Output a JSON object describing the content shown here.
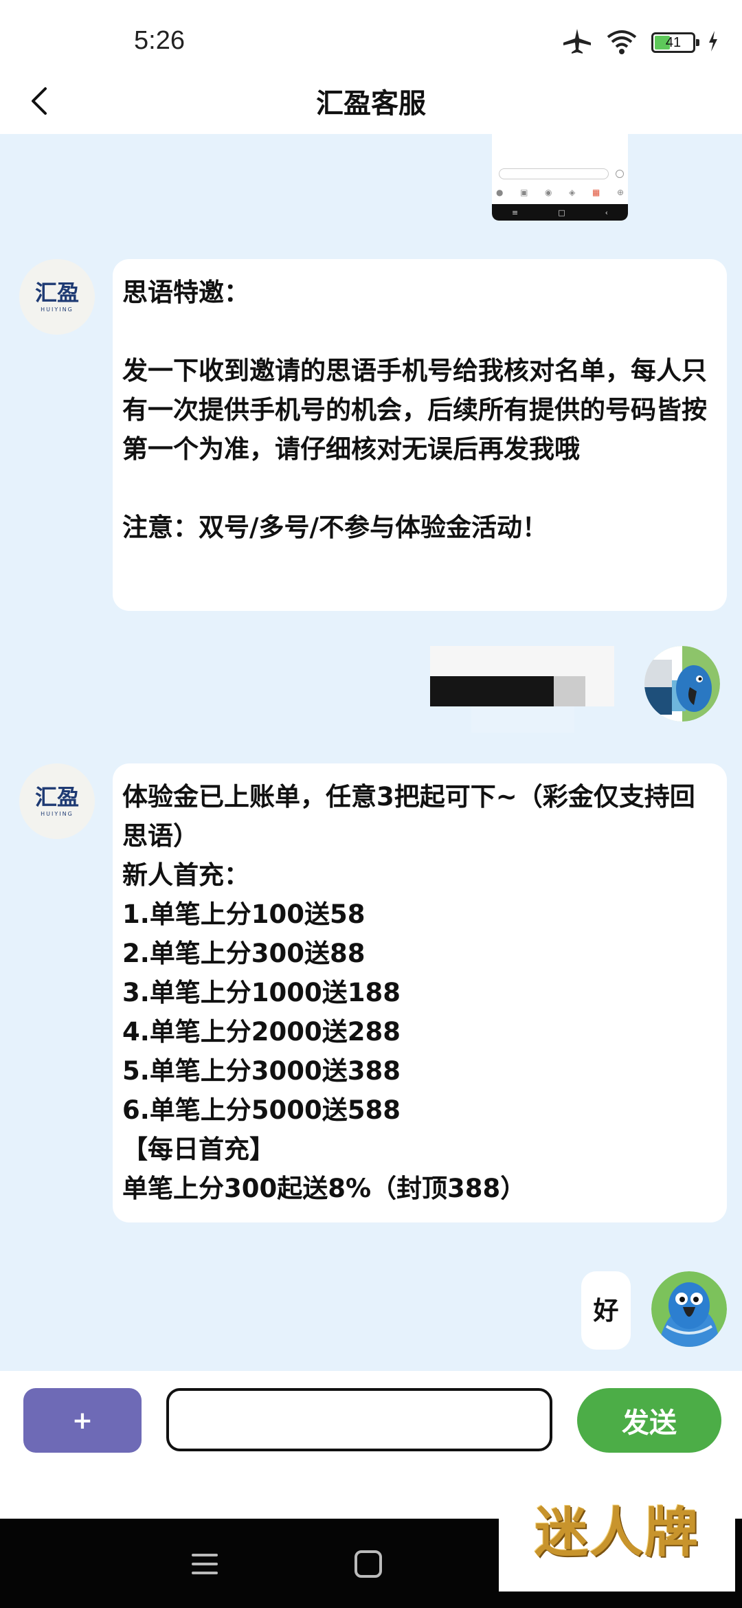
{
  "status_bar": {
    "time": "5:26",
    "battery_level": "41",
    "battery_fraction": 0.41
  },
  "header": {
    "title": "汇盈客服"
  },
  "chat": {
    "agent_logo": {
      "main": "汇盈",
      "sub": "HUIYING"
    },
    "messages": [
      {
        "from": "agent",
        "text": "思语特邀：\n\n发一下收到邀请的思语手机号给我核对名单，每人只有一次提供手机号的机会，后续所有提供的号码皆按第一个为准，请仔细核对无误后再发我哦\n\n注意：双号/多号/不参与体验金活动！"
      },
      {
        "from": "agent",
        "text": "体验金已上账单，任意3把起可下~（彩金仅支持回思语）\n新人首充：\n1.单笔上分100送58\n2.单笔上分300送88\n3.单笔上分1000送188\n4.单笔上分2000送288\n5.单笔上分3000送388\n6.单笔上分5000送588\n【每日首充】\n单笔上分300起送8%（封顶388）"
      },
      {
        "from": "user",
        "text": "好"
      }
    ]
  },
  "input_bar": {
    "plus_label": "+",
    "input_placeholder": "",
    "send_label": "发送"
  },
  "watermark": {
    "text": "迷人牌"
  },
  "colors": {
    "chat_bg": "#e6f2fc",
    "plus_button": "#6e6ab6",
    "send_button": "#4cad47",
    "logo": "#1e3a73"
  }
}
